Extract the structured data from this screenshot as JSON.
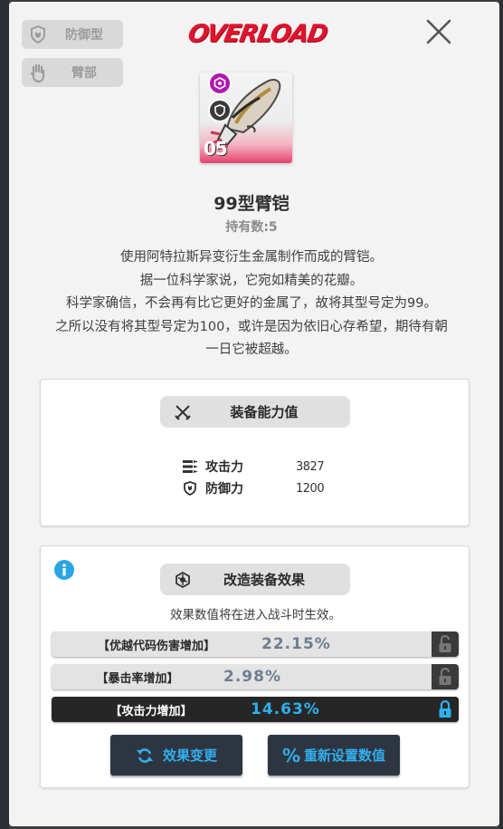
{
  "tags": [
    {
      "icon": "shield-icon",
      "label": "防御型"
    },
    {
      "icon": "hand-icon",
      "label": "臂部"
    }
  ],
  "logo": "OVERLOAD",
  "item": {
    "level": "05",
    "name": "99型臂铠",
    "count_text": "持有数:5",
    "description": [
      "使用阿特拉斯异变衍生金属制作而成的臂铠。",
      "据一位科学家说，它宛如精美的花瓣。",
      "科学家确信，不会再有比它更好的金属了，故将其型号定为99。",
      "之所以没有将其型号定为100，或许是因为依旧心存希望，期待有朝",
      "一日它被超越。"
    ]
  },
  "stats_section": {
    "title": "装备能力值",
    "stats": [
      {
        "icon": "attack-icon",
        "label": "攻击力",
        "value": "3827"
      },
      {
        "icon": "defense-icon",
        "label": "防御力",
        "value": "1200"
      }
    ]
  },
  "effects_section": {
    "title": "改造装备效果",
    "note": "效果数值将在进入战斗时生效。",
    "effects": [
      {
        "label": "【优越代码伤害增加】",
        "value": "22.15%",
        "locked": false
      },
      {
        "label": "【暴击率增加】",
        "value": "2.98%",
        "locked": false
      },
      {
        "label": "【攻击力增加】",
        "value": "14.63%",
        "locked": true
      }
    ],
    "buttons": {
      "change_label": "效果变更",
      "reset_label": "重新设置数值"
    }
  },
  "colors": {
    "accent": "#33aef0",
    "logo": "#e0142c",
    "card_bottom": "#e8426b",
    "button_bg": "#2d3640"
  }
}
